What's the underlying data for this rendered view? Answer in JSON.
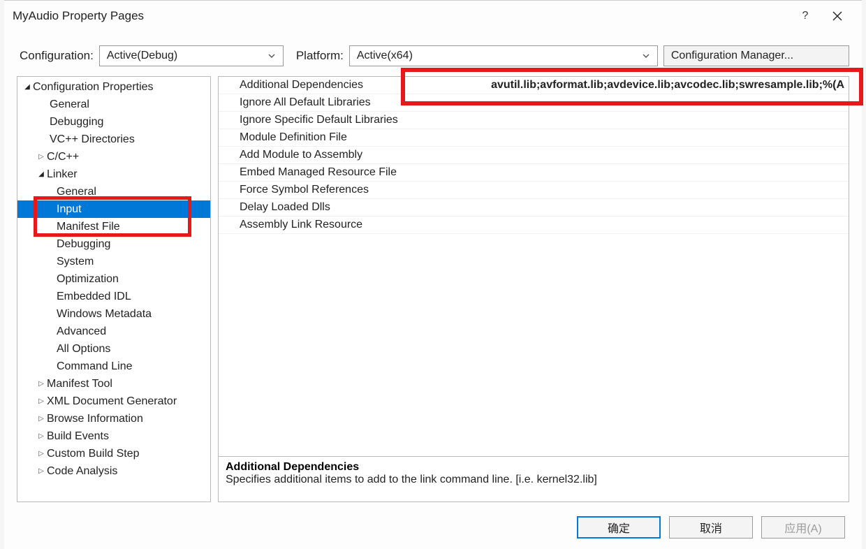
{
  "title": "MyAudio Property Pages",
  "help": "?",
  "config": {
    "label": "Configuration:",
    "value": "Active(Debug)",
    "platform_label": "Platform:",
    "platform_value": "Active(x64)",
    "manager": "Configuration Manager..."
  },
  "tree": {
    "root": "Configuration Properties",
    "items1": [
      "General",
      "Debugging",
      "VC++ Directories"
    ],
    "cxx": "C/C++",
    "linker": "Linker",
    "linker_children": [
      "General",
      "Input",
      "Manifest File",
      "Debugging",
      "System",
      "Optimization",
      "Embedded IDL",
      "Windows Metadata",
      "Advanced",
      "All Options",
      "Command Line"
    ],
    "items2": [
      "Manifest Tool",
      "XML Document Generator",
      "Browse Information",
      "Build Events",
      "Custom Build Step",
      "Code Analysis"
    ]
  },
  "grid": {
    "rows": [
      {
        "k": "Additional Dependencies",
        "v": "avutil.lib;avformat.lib;avdevice.lib;avcodec.lib;swresample.lib;%(A"
      },
      {
        "k": "Ignore All Default Libraries",
        "v": ""
      },
      {
        "k": "Ignore Specific Default Libraries",
        "v": ""
      },
      {
        "k": "Module Definition File",
        "v": ""
      },
      {
        "k": "Add Module to Assembly",
        "v": ""
      },
      {
        "k": "Embed Managed Resource File",
        "v": ""
      },
      {
        "k": "Force Symbol References",
        "v": ""
      },
      {
        "k": "Delay Loaded Dlls",
        "v": ""
      },
      {
        "k": "Assembly Link Resource",
        "v": ""
      }
    ]
  },
  "desc": {
    "title": "Additional Dependencies",
    "text": "Specifies additional items to add to the link command line. [i.e. kernel32.lib]"
  },
  "buttons": {
    "ok": "确定",
    "cancel": "取消",
    "apply": "应用(A)"
  }
}
